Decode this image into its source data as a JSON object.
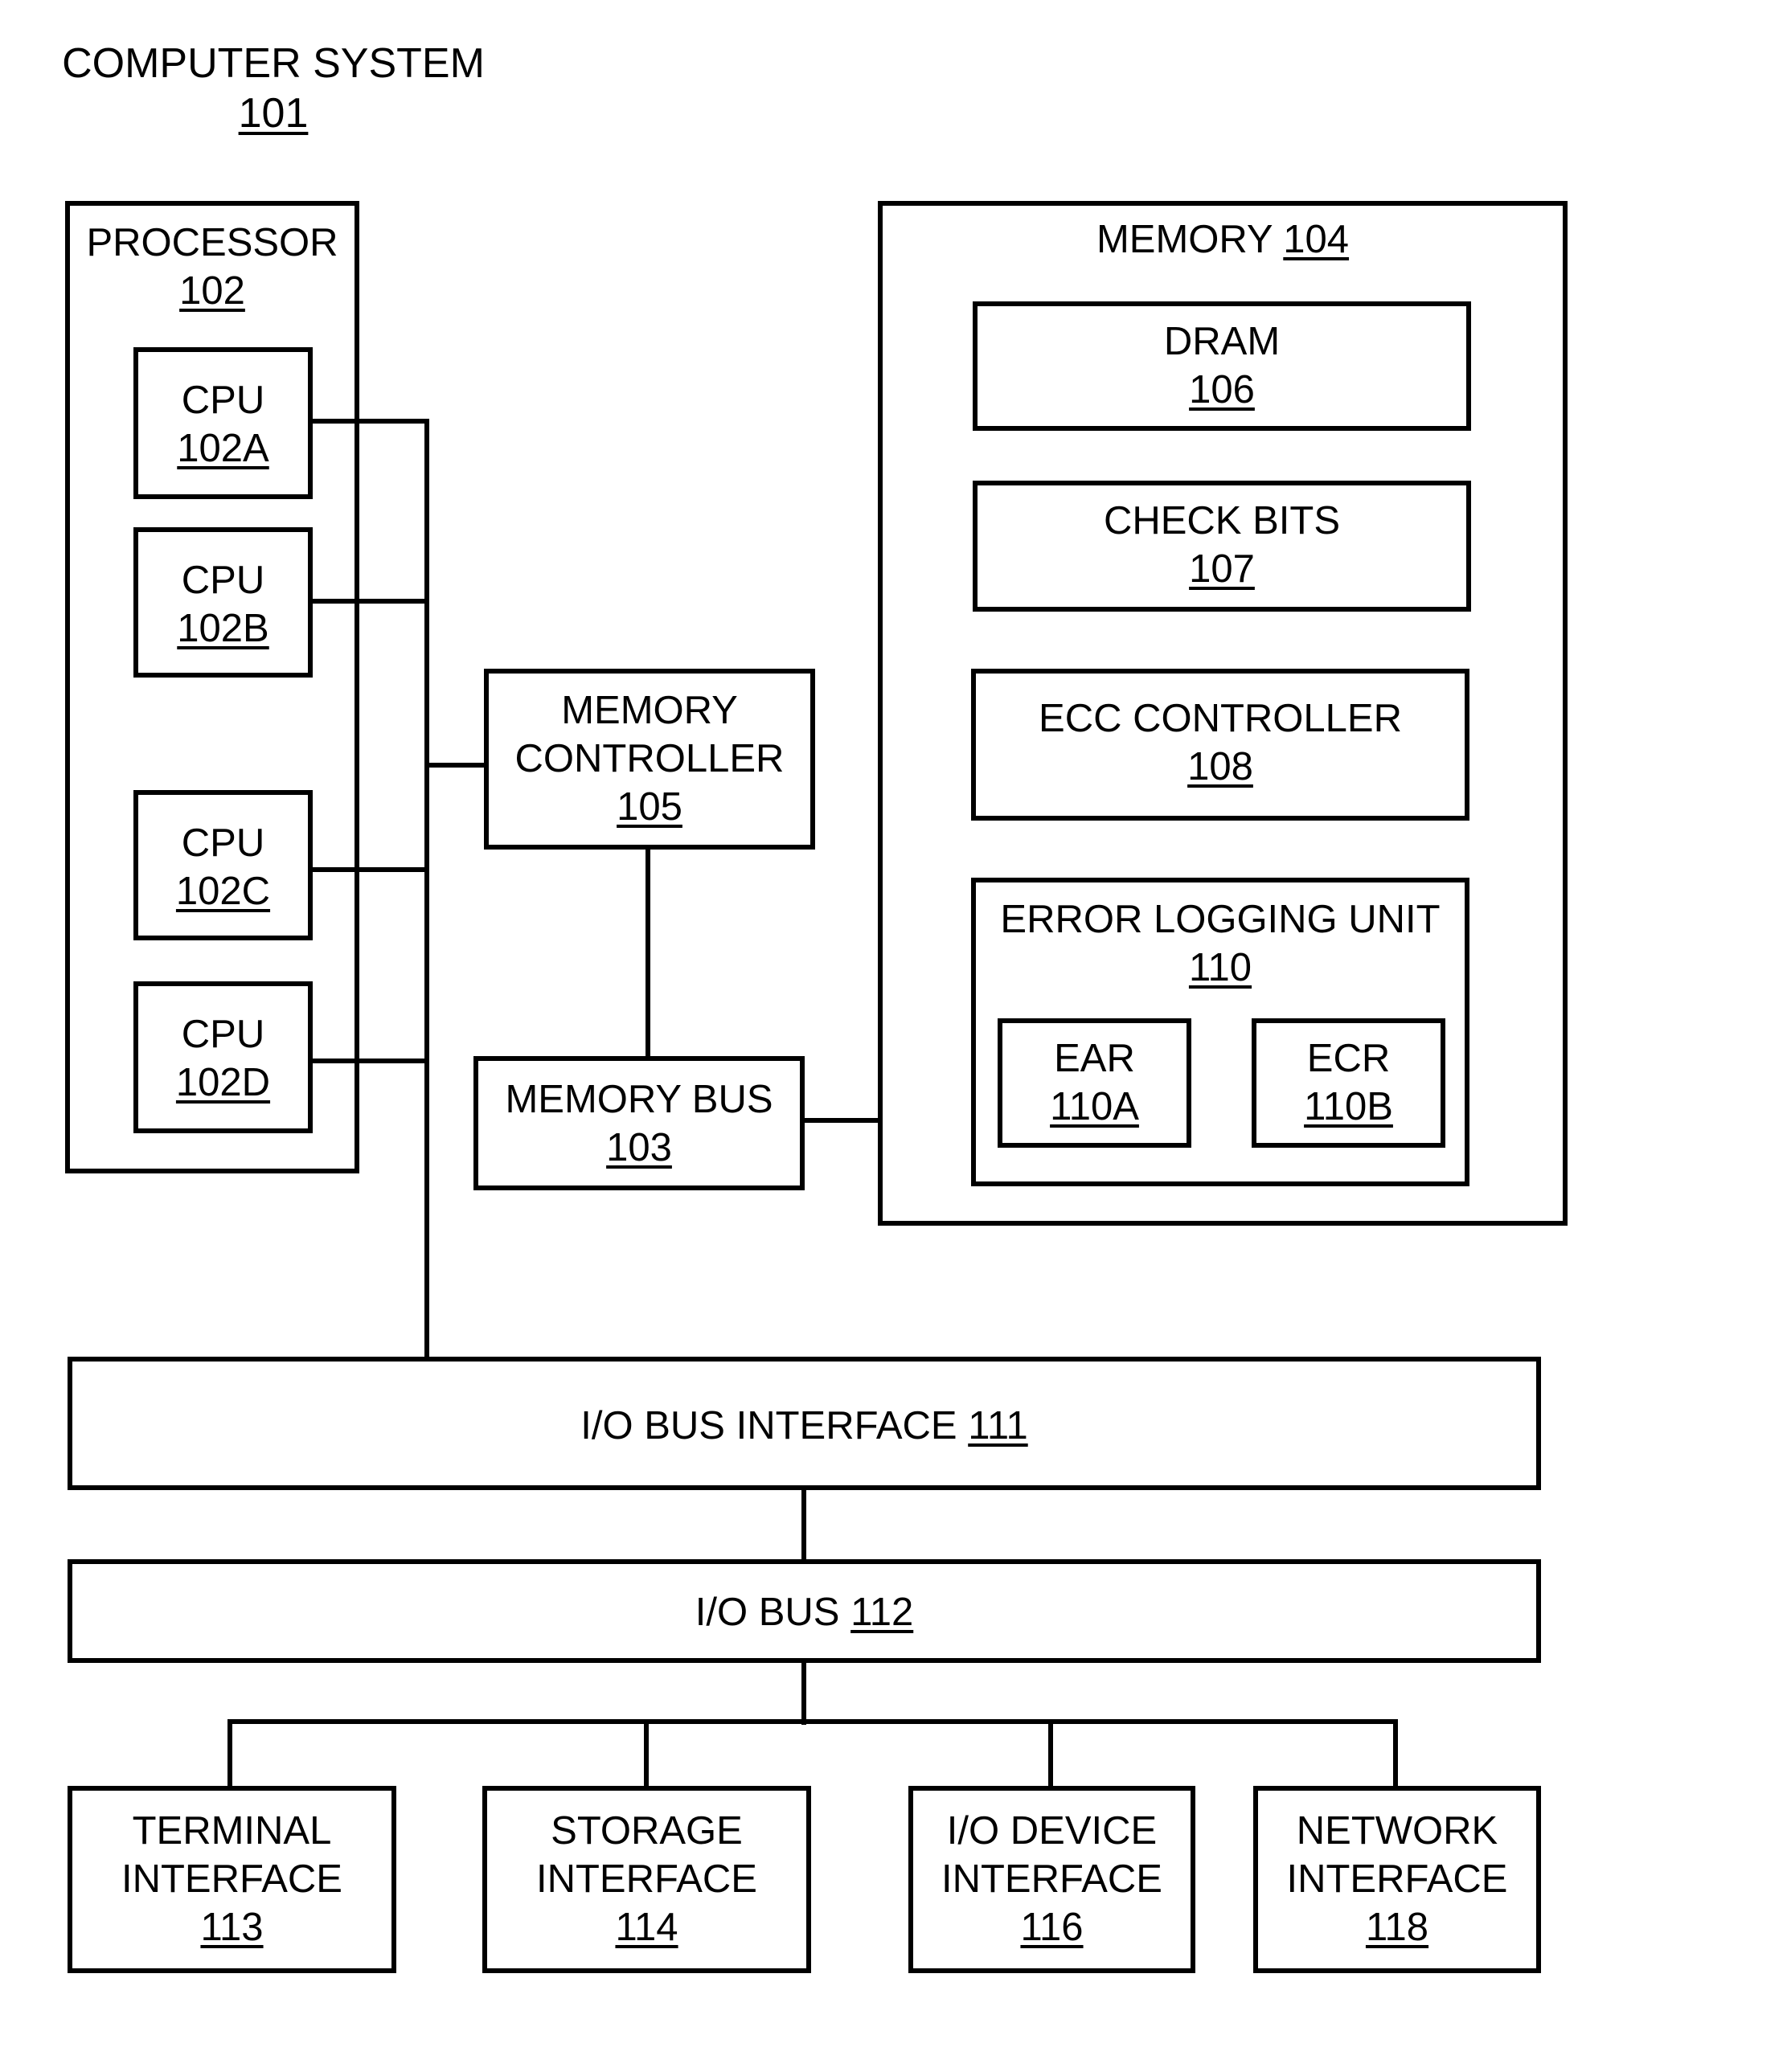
{
  "figure": {
    "title": "COMPUTER SYSTEM",
    "title_ref": "101"
  },
  "processor": {
    "label": "PROCESSOR",
    "ref": "102",
    "cpus": [
      {
        "label": "CPU",
        "ref": "102A"
      },
      {
        "label": "CPU",
        "ref": "102B"
      },
      {
        "label": "CPU",
        "ref": "102C"
      },
      {
        "label": "CPU",
        "ref": "102D"
      }
    ]
  },
  "memory_controller": {
    "line1": "MEMORY",
    "line2": "CONTROLLER",
    "ref": "105"
  },
  "memory_bus": {
    "label": "MEMORY BUS",
    "ref": "103"
  },
  "memory": {
    "label": "MEMORY",
    "ref": "104",
    "dram": {
      "label": "DRAM",
      "ref": "106"
    },
    "check_bits": {
      "label": "CHECK BITS",
      "ref": "107"
    },
    "ecc_controller": {
      "label": "ECC CONTROLLER",
      "ref": "108"
    },
    "error_logging_unit": {
      "label": "ERROR LOGGING UNIT",
      "ref": "110",
      "ear": {
        "label": "EAR",
        "ref": "110A"
      },
      "ecr": {
        "label": "ECR",
        "ref": "110B"
      }
    }
  },
  "io_bus_interface": {
    "label": "I/O BUS INTERFACE",
    "ref": "111"
  },
  "io_bus": {
    "label": "I/O BUS",
    "ref": "112"
  },
  "interfaces": [
    {
      "line1": "TERMINAL",
      "line2": "INTERFACE",
      "ref": "113"
    },
    {
      "line1": "STORAGE",
      "line2": "INTERFACE",
      "ref": "114"
    },
    {
      "line1": "I/O DEVICE",
      "line2": "INTERFACE",
      "ref": "116"
    },
    {
      "line1": "NETWORK",
      "line2": "INTERFACE",
      "ref": "118"
    }
  ]
}
